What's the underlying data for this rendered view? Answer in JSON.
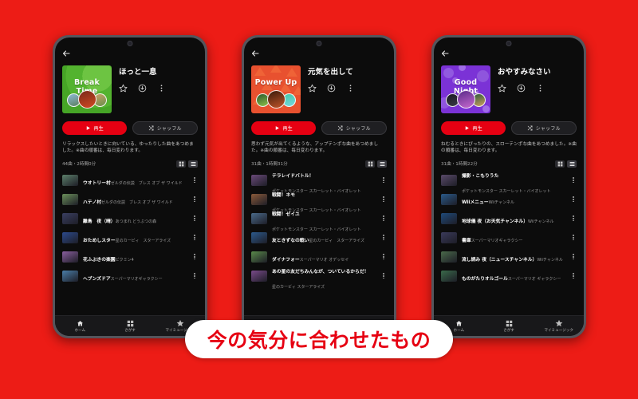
{
  "background_color": "#ED1C16",
  "caption": {
    "text": "今の気分に合わせたもの",
    "color": "#E60012"
  },
  "bottom_nav": {
    "items": [
      {
        "label": "ホーム",
        "icon": "home-icon"
      },
      {
        "label": "さがす",
        "icon": "grid-icon"
      },
      {
        "label": "マイミュージック",
        "icon": "star-icon"
      }
    ]
  },
  "common": {
    "back_icon": "back-arrow-icon",
    "favorite_icon": "star-outline-icon",
    "download_icon": "download-circle-icon",
    "overflow_icon": "more-vertical-icon",
    "play_label": "再生",
    "play_icon": "play-icon",
    "shuffle_label": "シャッフル",
    "shuffle_icon": "shuffle-icon",
    "grid_view_icon": "grid-view-icon",
    "list_view_icon": "list-view-icon"
  },
  "phones": [
    {
      "id": "phone-break-time",
      "art_text": "Break Time",
      "art_style": "green",
      "title": "ほっと一息",
      "description": "リラックスしたいときに向いている、ゆったりした曲をあつめました。※曲の順番は、毎日変わります。",
      "meta": "44曲・2時間0分",
      "tracks": [
        {
          "name": "ウオトリー村",
          "album": "ゼルダの伝説　ブレス オブ ザ ワイルド",
          "thumb": "#5c7f6a"
        },
        {
          "name": "ハテノ村",
          "album": "ゼルダの伝説　ブレス オブ ザ ワイルド",
          "thumb": "#6b8f5a"
        },
        {
          "name": "離島　夜（晴）",
          "album": "あつまれ どうぶつの森",
          "thumb": "#3a3f62"
        },
        {
          "name": "おためしスター",
          "album": "星のカービィ　スターアライズ",
          "thumb": "#2c4a8c"
        },
        {
          "name": "花ふぶきの楽園",
          "album": "ピクミン4",
          "thumb": "#8a5f9e"
        },
        {
          "name": "ヘブンズドア",
          "album": "スーパーマリオギャラクシー",
          "thumb": "#4a7ea8"
        }
      ]
    },
    {
      "id": "phone-power-up",
      "art_text": "Power Up",
      "art_style": "orange",
      "title": "元気を出して",
      "description": "思わず元気が出てくるような、アップテンポな曲をあつめました。※曲の順番は、毎日変わります。",
      "meta": "31曲・1時間31分",
      "tracks": [
        {
          "name": "テラレイドバトル！",
          "album": "ポケットモンスター スカーレット・バイオレット",
          "thumb": "#6b4a7a"
        },
        {
          "name": "戦闘！ネモ",
          "album": "ポケットモンスター スカーレット・バイオレット",
          "thumb": "#8a5a3a"
        },
        {
          "name": "戦闘！ゼイユ",
          "album": "ポケットモンスター スカーレット・バイオレット",
          "thumb": "#4a6a8a"
        },
        {
          "name": "友ときずなの戦い",
          "album": "星のカービィ　スターアライズ",
          "thumb": "#2c5a8c"
        },
        {
          "name": "ダイナフォー",
          "album": "スーパーマリオ オデッセイ",
          "thumb": "#5a8a4a"
        },
        {
          "name": "あの星の友だちみんなが、ついているからだ！",
          "album": "星のカービィ スターアライズ",
          "thumb": "#7a4a8a"
        }
      ]
    },
    {
      "id": "phone-good-night",
      "art_text": "Good Night",
      "art_style": "purple",
      "title": "おやすみなさい",
      "description": "ねむるときにぴったりの、スローテンポな曲をあつめました。※曲の順番は、毎日変わります。",
      "meta": "31曲・1時間22分",
      "tracks": [
        {
          "name": "撮影・こもりうた",
          "album": "ポケットモンスター スカーレット・バイオレット",
          "thumb": "#5a4a6a"
        },
        {
          "name": "Wiiメニュー",
          "album": "Wiiチャンネル",
          "thumb": "#2a5a8a"
        },
        {
          "name": "地球儀 夜（お天気チャンネル）",
          "album": "Wiiチャンネル",
          "thumb": "#1f4a7a"
        },
        {
          "name": "書庫",
          "album": "スーパーマリオギャラクシー",
          "thumb": "#3a3a5a"
        },
        {
          "name": "流し読み 夜（ニュースチャンネル）",
          "album": "Wiiチャンネル",
          "thumb": "#4a6a4a"
        },
        {
          "name": "ものがたりオルゴール",
          "album": "スーパーマリオ ギャラクシー",
          "thumb": "#3a6a4a"
        }
      ]
    }
  ]
}
